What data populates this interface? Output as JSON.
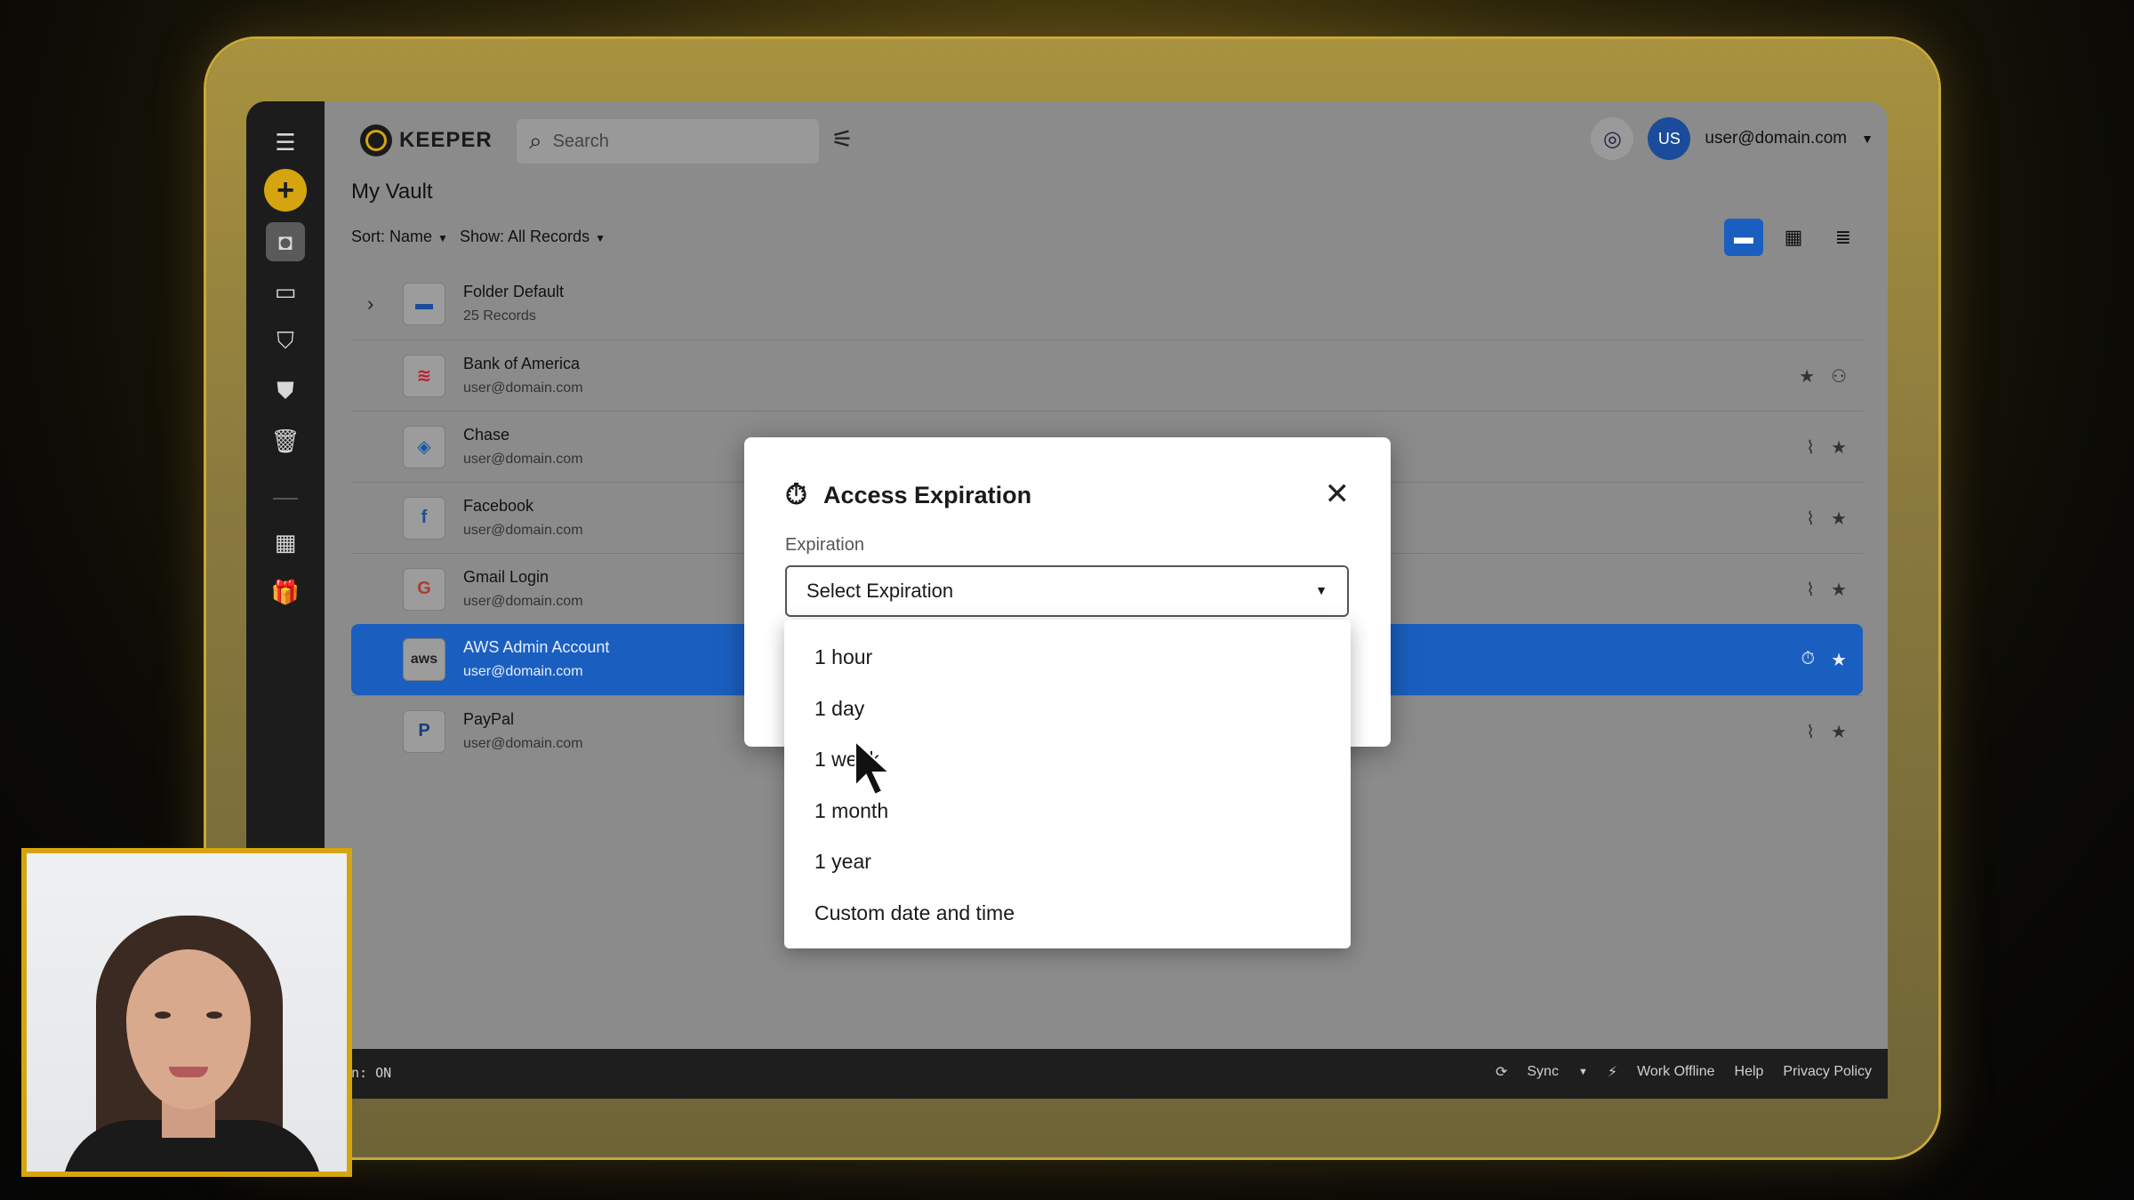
{
  "app": {
    "logo_text": "KEEPER",
    "search_placeholder": "Search",
    "user_initials": "US",
    "user_email": "user@domain.com",
    "vault_title": "My Vault",
    "sort_label": "Sort: Name",
    "show_label": "Show: All Records"
  },
  "records": [
    {
      "name": "Folder Default",
      "sub": "25 Records",
      "icon": "folder-icon"
    },
    {
      "name": "Bank of America",
      "sub": "user@domain.com",
      "icon": "bank-of-america-logo"
    },
    {
      "name": "Chase",
      "sub": "user@domain.com",
      "icon": "chase-logo"
    },
    {
      "name": "Facebook",
      "sub": "user@domain.com",
      "icon": "facebook-logo"
    },
    {
      "name": "Gmail Login",
      "sub": "user@domain.com",
      "icon": "google-logo"
    },
    {
      "name": "AWS Admin Account",
      "sub": "user@domain.com",
      "icon": "aws-logo",
      "thumb_text": "aws",
      "selected": true
    },
    {
      "name": "PayPal",
      "sub": "user@domain.com",
      "icon": "paypal-logo"
    }
  ],
  "modal": {
    "title": "Access Expiration",
    "field_label": "Expiration",
    "select_value": "Select Expiration",
    "options": [
      "1 hour",
      "1 day",
      "1 week",
      "1 month",
      "1 year",
      "Custom date and time"
    ]
  },
  "bottombar": {
    "left_text": "n: ON",
    "sync": "Sync",
    "work_offline": "Work Offline",
    "help": "Help",
    "privacy": "Privacy Policy"
  },
  "colors": {
    "accent": "#1a5fc0",
    "brand_gold": "#d4a50f",
    "sidebar": "#1c1c1c"
  }
}
